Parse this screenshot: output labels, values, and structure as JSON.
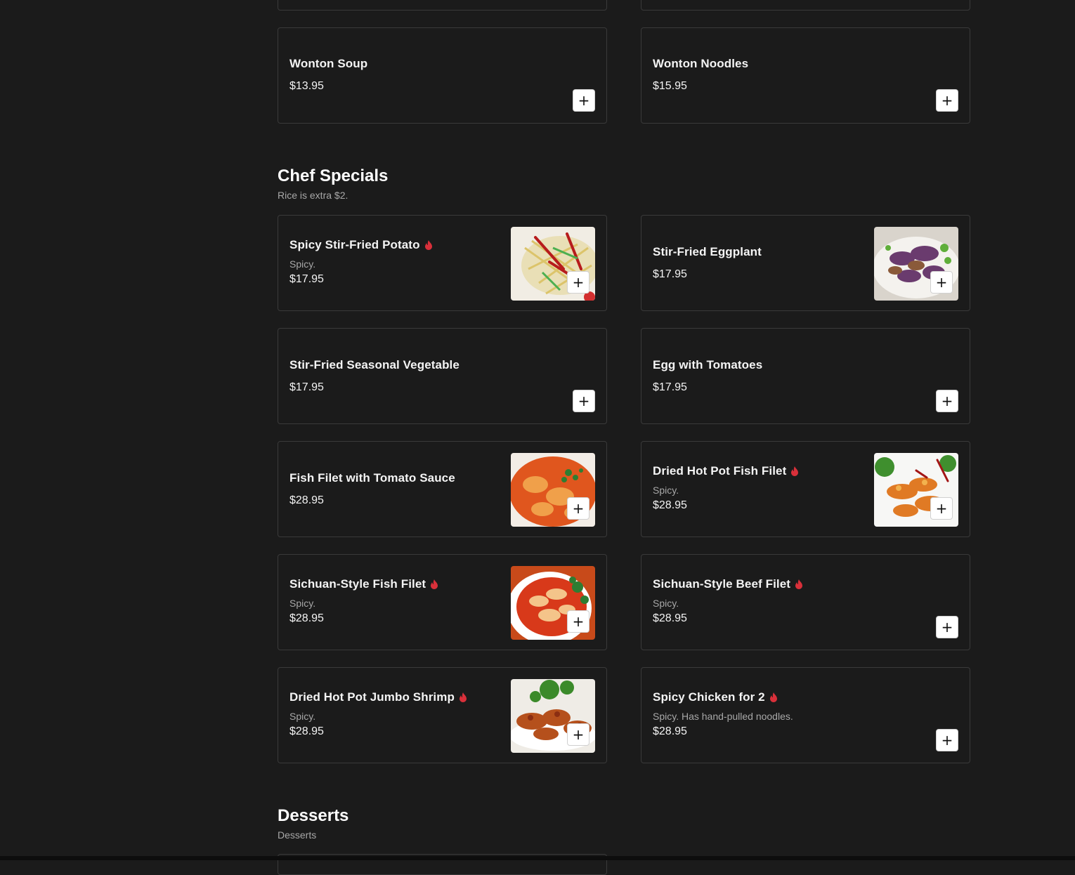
{
  "colors": {
    "background": "#1b1b1b",
    "card_border": "#3a3a3a",
    "spicy": "#d9303a",
    "button": "#ffffff"
  },
  "add_button_label": "+",
  "top_items": [
    {
      "name": "Wonton Soup",
      "price": "$13.95"
    },
    {
      "name": "Wonton Noodles",
      "price": "$15.95"
    }
  ],
  "chef_specials": {
    "title": "Chef Specials",
    "subtitle": "Rice is extra $2.",
    "items": [
      {
        "name": "Spicy Stir-Fried Potato",
        "spicy": true,
        "description": "Spicy.",
        "price": "$17.95",
        "image": "stir-fried-potato"
      },
      {
        "name": "Stir-Fried Eggplant",
        "spicy": false,
        "description": "",
        "price": "$17.95",
        "image": "eggplant"
      },
      {
        "name": "Stir-Fried Seasonal Vegetable",
        "spicy": false,
        "description": "",
        "price": "$17.95",
        "image": ""
      },
      {
        "name": "Egg with Tomatoes",
        "spicy": false,
        "description": "",
        "price": "$17.95",
        "image": ""
      },
      {
        "name": "Fish Filet with Tomato Sauce",
        "spicy": false,
        "description": "",
        "price": "$28.95",
        "image": "fish-tomato"
      },
      {
        "name": "Dried Hot Pot Fish Filet",
        "spicy": true,
        "description": "Spicy.",
        "price": "$28.95",
        "image": "hot-pot-fish"
      },
      {
        "name": "Sichuan-Style Fish Filet",
        "spicy": true,
        "description": "Spicy.",
        "price": "$28.95",
        "image": "sichuan-fish"
      },
      {
        "name": "Sichuan-Style Beef Filet",
        "spicy": true,
        "description": "Spicy.",
        "price": "$28.95",
        "image": ""
      },
      {
        "name": "Dried Hot Pot Jumbo Shrimp",
        "spicy": true,
        "description": "Spicy.",
        "price": "$28.95",
        "image": "jumbo-shrimp"
      },
      {
        "name": "Spicy Chicken for 2",
        "spicy": true,
        "description": "Spicy. Has hand-pulled noodles.",
        "price": "$28.95",
        "image": ""
      }
    ]
  },
  "desserts": {
    "title": "Desserts",
    "subtitle": "Desserts"
  }
}
